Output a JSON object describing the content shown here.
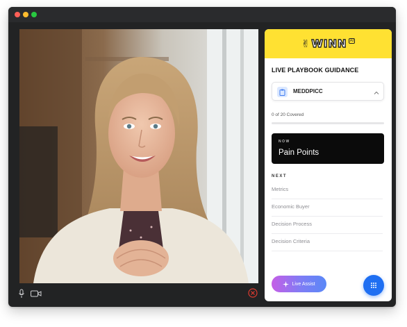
{
  "window": {
    "traffic_lights": [
      "close",
      "minimize",
      "zoom"
    ]
  },
  "video": {
    "subject": "participant-video-feed"
  },
  "call_controls": {
    "icons": [
      "microphone-icon",
      "camera-icon",
      "end-call-icon"
    ],
    "end_call_color": "#e03a2f"
  },
  "panel": {
    "brand": {
      "logo_text": "WINN",
      "logo_mark": "AI",
      "header_color": "#ffe132"
    },
    "title": "LIVE PLAYBOOK GUIDANCE",
    "playbook_select": {
      "selected": "MEDDPICC",
      "icon": "clipboard-icon"
    },
    "progress": {
      "text": "0 of 20 Covered",
      "covered": 0,
      "total": 20
    },
    "now": {
      "tag": "NOW",
      "title": "Pain Points"
    },
    "next": {
      "tag": "NEXT",
      "items": [
        "Metrics",
        "Economic Buyer",
        "Decision Process",
        "Decision Criteria"
      ]
    },
    "live_assist_label": "Live Assist",
    "accent_color": "#1f6ff2"
  }
}
